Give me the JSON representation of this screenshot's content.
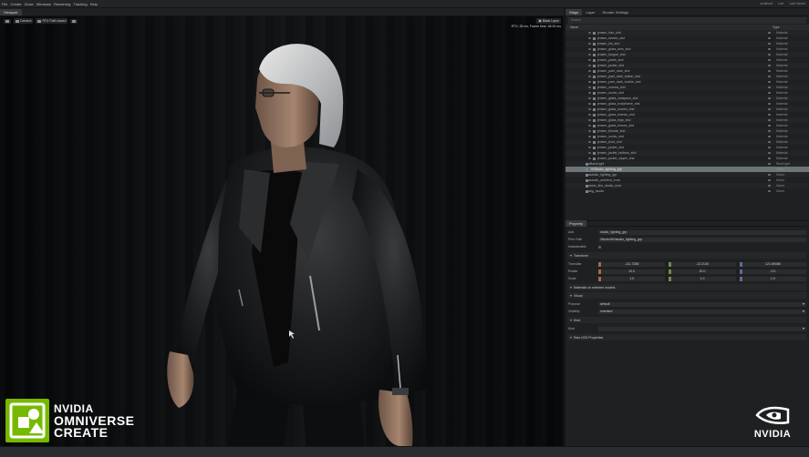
{
  "menubar": {
    "items": [
      "File",
      "Create",
      "Close",
      "Windows",
      "Rendering",
      "Tracking",
      "Help"
    ],
    "right": [
      "localhost",
      "Live",
      "Last Saved"
    ]
  },
  "viewport": {
    "tab": "Viewport",
    "camera_label": "Camera",
    "render_mode": "RTX Path-traced",
    "stats": "RTX: 28 ms, Frame time: 48.00 ms",
    "layout_label": "Black Layer"
  },
  "logo": {
    "line1": "NVIDIA",
    "line2": "OMNIVERSE",
    "line3": "CREATE",
    "accent": "#76b900"
  },
  "watermark": {
    "text": "NVIDIA"
  },
  "stage": {
    "tabs": [
      "Stage",
      "Layer",
      "Render Settings"
    ],
    "search_placeholder": "Search",
    "col_name": "Name",
    "col_type": "Type",
    "rows": [
      {
        "name": "jensen_hair_shd",
        "type": "Material",
        "indent": 1
      },
      {
        "name": "jensen_lashes_shd",
        "type": "Material",
        "indent": 1
      },
      {
        "name": "jensen_iris_shd",
        "type": "Material",
        "indent": 1
      },
      {
        "name": "jensen_glass_lens_shd",
        "type": "Material",
        "indent": 1
      },
      {
        "name": "jensen_tongue_shd",
        "type": "Material",
        "indent": 1
      },
      {
        "name": "jensen_pants_shd",
        "type": "Material",
        "indent": 1
      },
      {
        "name": "jensen_jacket_shd",
        "type": "Material",
        "indent": 1
      },
      {
        "name": "jensen_pant_dark_shd",
        "type": "Material",
        "indent": 1
      },
      {
        "name": "jensen_pant_dark_button_shd",
        "type": "Material",
        "indent": 1
      },
      {
        "name": "jensen_pant_dark_buckle_shd",
        "type": "Material",
        "indent": 1
      },
      {
        "name": "jensen_cornea_shd",
        "type": "Material",
        "indent": 1
      },
      {
        "name": "jensen_socks_shd",
        "type": "Material",
        "indent": 1
      },
      {
        "name": "jensen_glass_carapace_shd",
        "type": "Material",
        "indent": 1
      },
      {
        "name": "jensen_glass_bodyframe_shd",
        "type": "Material",
        "indent": 1
      },
      {
        "name": "jensen_glass_screen_shd",
        "type": "Material",
        "indent": 1
      },
      {
        "name": "jensen_glass_frames_shd",
        "type": "Material",
        "indent": 1
      },
      {
        "name": "jensen_glass_legs_shd",
        "type": "Material",
        "indent": 1
      },
      {
        "name": "jensen_glass_lenses_shd",
        "type": "Material",
        "indent": 1
      },
      {
        "name": "jensen_blonde_shd",
        "type": "Material",
        "indent": 1
      },
      {
        "name": "jensen_socks_shd",
        "type": "Material",
        "indent": 1
      },
      {
        "name": "jensen_boot_shd",
        "type": "Material",
        "indent": 1
      },
      {
        "name": "jensen_jacket_shd",
        "type": "Material",
        "indent": 1
      },
      {
        "name": "jensen_jacket_buttons_shd",
        "type": "Material",
        "indent": 1
      },
      {
        "name": "jensen_jacket_zipper_shd",
        "type": "Material",
        "indent": 1
      },
      {
        "name": "BackLight",
        "type": "RectLight",
        "indent": 0
      },
      {
        "name": "NVStudio_lighting_grp",
        "type": "Xform",
        "indent": 0,
        "selected": true
      },
      {
        "name": "studio_lighting_grp",
        "type": "Xform",
        "indent": 0
      },
      {
        "name": "studio_ambient_envs",
        "type": "Xform",
        "indent": 0
      },
      {
        "name": "new_dlm_studio_mod",
        "type": "Xform",
        "indent": 0
      },
      {
        "name": "bg_studio",
        "type": "Xform",
        "indent": 0
      }
    ]
  },
  "property": {
    "tabs": [
      "Property"
    ],
    "add_label": "Add",
    "name_value": "studio_lighting_grp",
    "path_label": "Prim Path",
    "path_value": "/Studio/NVstudio_lighting_grp",
    "instanceable_label": "Instanceable",
    "transform_section": "Transform",
    "translate_label": "Translate",
    "translate": [
      "-111.7288",
      "-12.2130",
      "121.89468"
    ],
    "rotate_label": "Rotate",
    "rotate": [
      "10.0",
      "20.0",
      "-0.0"
    ],
    "scale_label": "Scale",
    "scale": [
      "1.0",
      "1.0",
      "1.0"
    ],
    "materials_section": "Materials on selected models",
    "visual_section": "Visual",
    "purpose_label": "Purpose",
    "purpose_value": "default",
    "visibility_label": "Visibility",
    "visibility_value": "inherited",
    "kind_section": "Kind",
    "kind_label": "Kind",
    "raw_section": "Raw USD Properties"
  }
}
